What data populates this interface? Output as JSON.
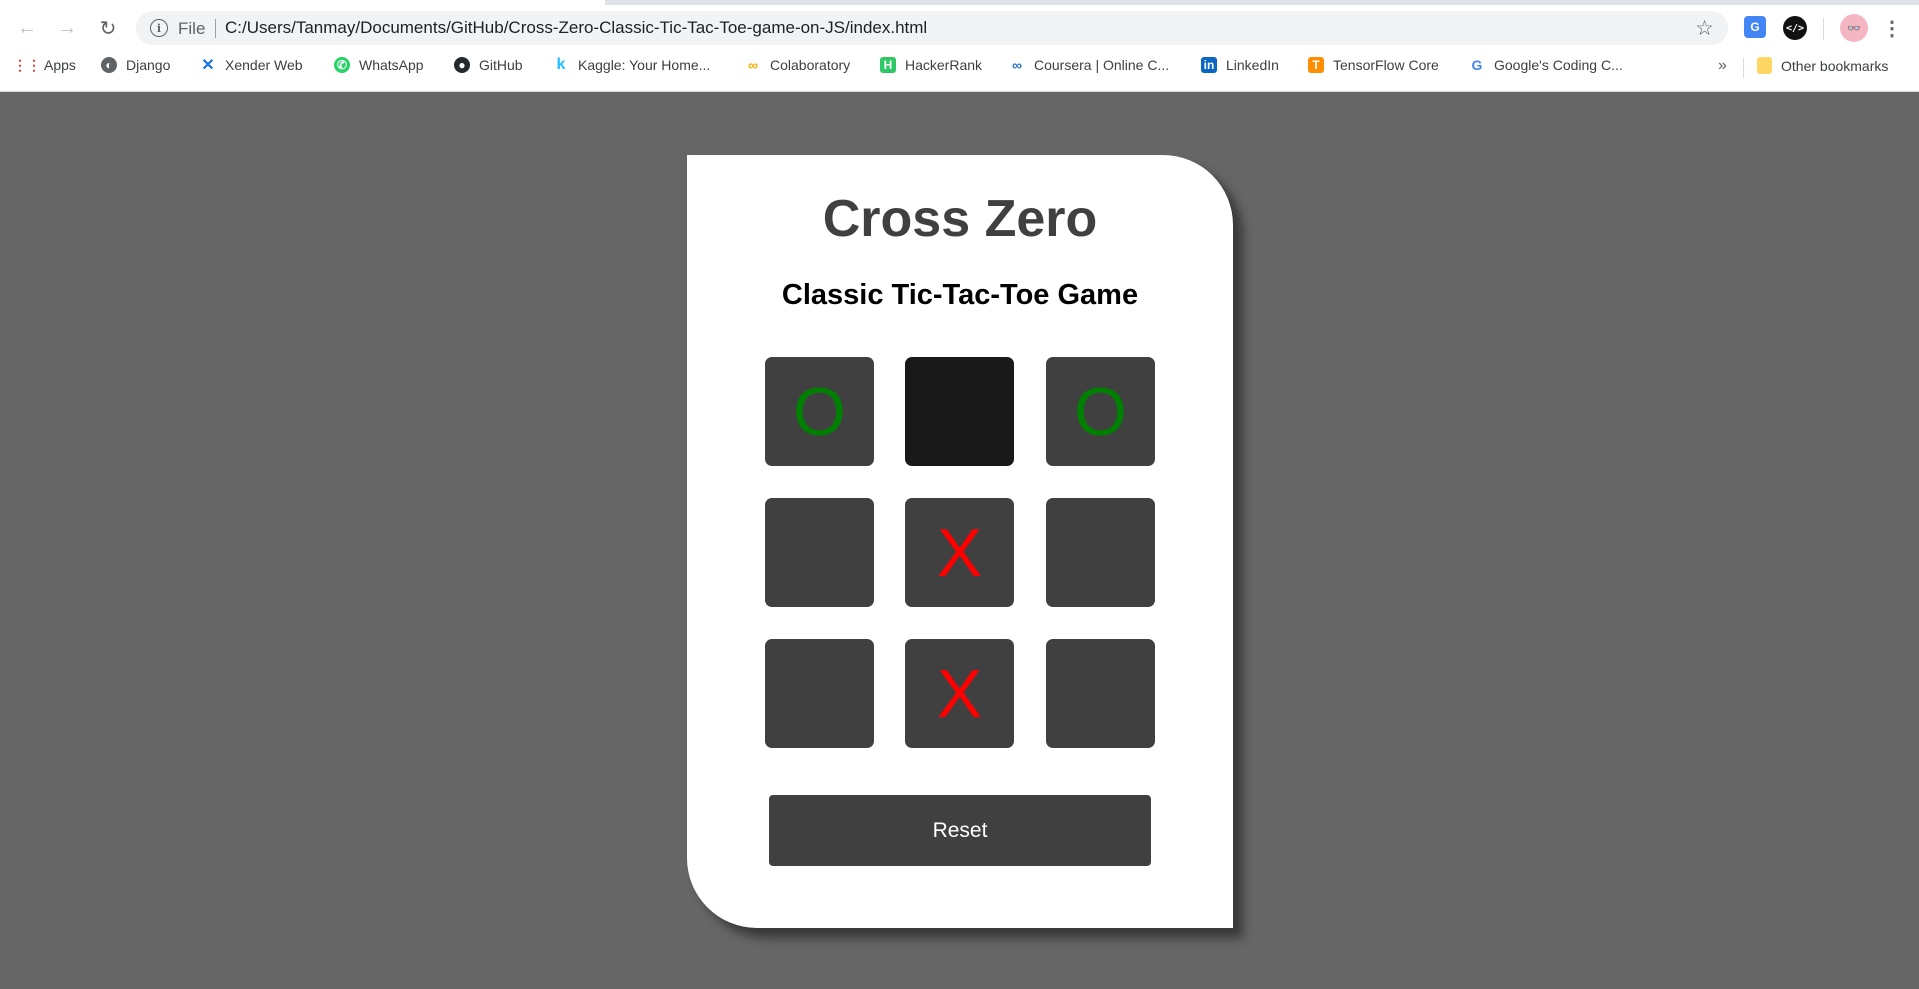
{
  "browser": {
    "nav": {
      "back": "←",
      "forward": "→",
      "reload": "↻"
    },
    "omnibox": {
      "info_icon": "i",
      "scheme_label": "File",
      "url": "C:/Users/Tanmay/Documents/GitHub/Cross-Zero-Classic-Tic-Tac-Toe-game-on-JS/index.html",
      "star": "☆"
    },
    "extensions": {
      "translate": "G",
      "code": "</>",
      "avatar": "👓",
      "menu": "⋮"
    },
    "bookmarks": [
      {
        "label": "Apps",
        "icon": "apps-grid-icon",
        "color": "#ea4335"
      },
      {
        "label": "Django",
        "icon": "globe-icon",
        "color": "#5f6368"
      },
      {
        "label": "Xender Web",
        "icon": "xender-icon",
        "color": "#1a73e8"
      },
      {
        "label": "WhatsApp",
        "icon": "whatsapp-icon",
        "color": "#25d366"
      },
      {
        "label": "GitHub",
        "icon": "github-icon",
        "color": "#24292e"
      },
      {
        "label": "Kaggle: Your Home...",
        "icon": "kaggle-icon",
        "color": "#20beff"
      },
      {
        "label": "Colaboratory",
        "icon": "colab-icon",
        "color": "#f9ab00"
      },
      {
        "label": "HackerRank",
        "icon": "hackerrank-icon",
        "color": "#2ec866"
      },
      {
        "label": "Coursera | Online C...",
        "icon": "coursera-icon",
        "color": "#2a73cc"
      },
      {
        "label": "LinkedIn",
        "icon": "linkedin-icon",
        "color": "#0a66c2"
      },
      {
        "label": "TensorFlow Core",
        "icon": "tensorflow-icon",
        "color": "#ff8f00"
      },
      {
        "label": "Google's Coding C...",
        "icon": "google-icon",
        "color": "#4285f4"
      }
    ],
    "bookmarks_overflow": "»",
    "other_bookmarks": "Other bookmarks"
  },
  "game": {
    "title": "Cross Zero",
    "subtitle": "Classic Tic-Tac-Toe Game",
    "board": [
      "O",
      "",
      "O",
      "",
      "X",
      "",
      "",
      "X",
      ""
    ],
    "hovered_cell": 1,
    "reset_label": "Reset",
    "colors": {
      "o": "#008000",
      "x": "#ff0000",
      "cell": "#404040",
      "cell_hover": "#191919"
    }
  }
}
